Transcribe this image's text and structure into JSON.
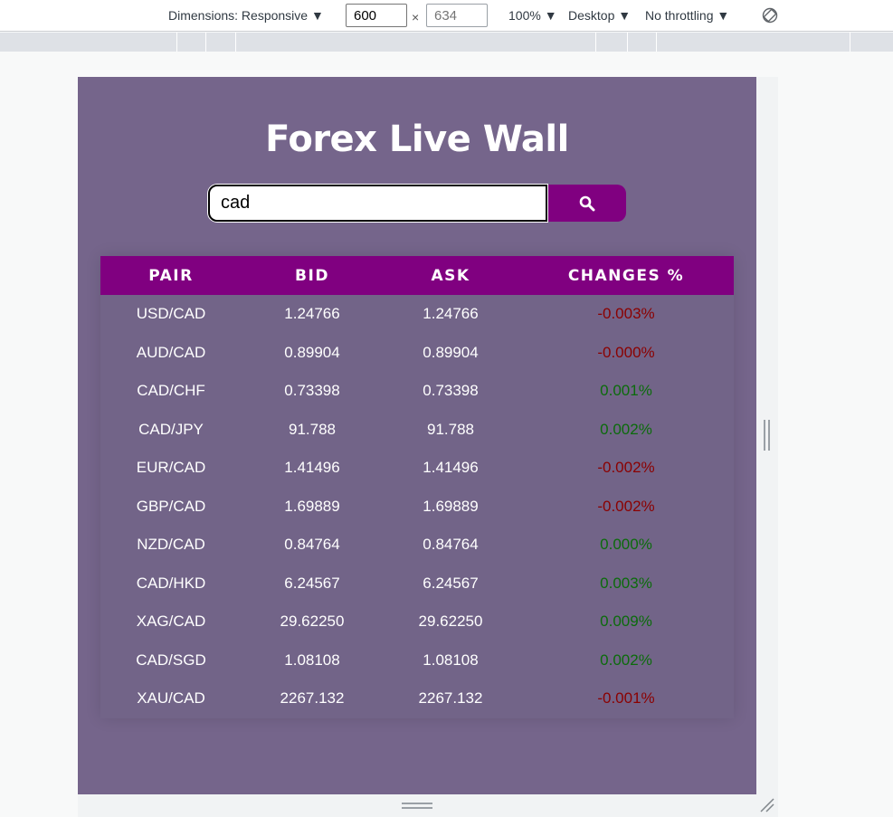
{
  "devtools": {
    "dimensions_label": "Dimensions: Responsive ▼",
    "width_value": "600",
    "height_placeholder": "634",
    "times_symbol": "×",
    "zoom_label": "100% ▼",
    "device_label": "Desktop ▼",
    "throttling_label": "No throttling ▼"
  },
  "page": {
    "title": "Forex Live Wall",
    "search_value": "cad",
    "accent_color": "#800080",
    "background_color": "#75658b"
  },
  "table": {
    "headers": [
      "PAIR",
      "BID",
      "ASK",
      "CHANGES %"
    ],
    "rows": [
      {
        "pair": "USD/CAD",
        "bid": "1.24766",
        "ask": "1.24766",
        "change": "-0.003%",
        "direction": "negative"
      },
      {
        "pair": "AUD/CAD",
        "bid": "0.89904",
        "ask": "0.89904",
        "change": "-0.000%",
        "direction": "negative"
      },
      {
        "pair": "CAD/CHF",
        "bid": "0.73398",
        "ask": "0.73398",
        "change": "0.001%",
        "direction": "positive"
      },
      {
        "pair": "CAD/JPY",
        "bid": "91.788",
        "ask": "91.788",
        "change": "0.002%",
        "direction": "positive"
      },
      {
        "pair": "EUR/CAD",
        "bid": "1.41496",
        "ask": "1.41496",
        "change": "-0.002%",
        "direction": "negative"
      },
      {
        "pair": "GBP/CAD",
        "bid": "1.69889",
        "ask": "1.69889",
        "change": "-0.002%",
        "direction": "negative"
      },
      {
        "pair": "NZD/CAD",
        "bid": "0.84764",
        "ask": "0.84764",
        "change": "0.000%",
        "direction": "positive"
      },
      {
        "pair": "CAD/HKD",
        "bid": "6.24567",
        "ask": "6.24567",
        "change": "0.003%",
        "direction": "positive"
      },
      {
        "pair": "XAG/CAD",
        "bid": "29.62250",
        "ask": "29.62250",
        "change": "0.009%",
        "direction": "positive"
      },
      {
        "pair": "CAD/SGD",
        "bid": "1.08108",
        "ask": "1.08108",
        "change": "0.002%",
        "direction": "positive"
      },
      {
        "pair": "XAU/CAD",
        "bid": "2267.132",
        "ask": "2267.132",
        "change": "-0.001%",
        "direction": "negative"
      }
    ]
  }
}
